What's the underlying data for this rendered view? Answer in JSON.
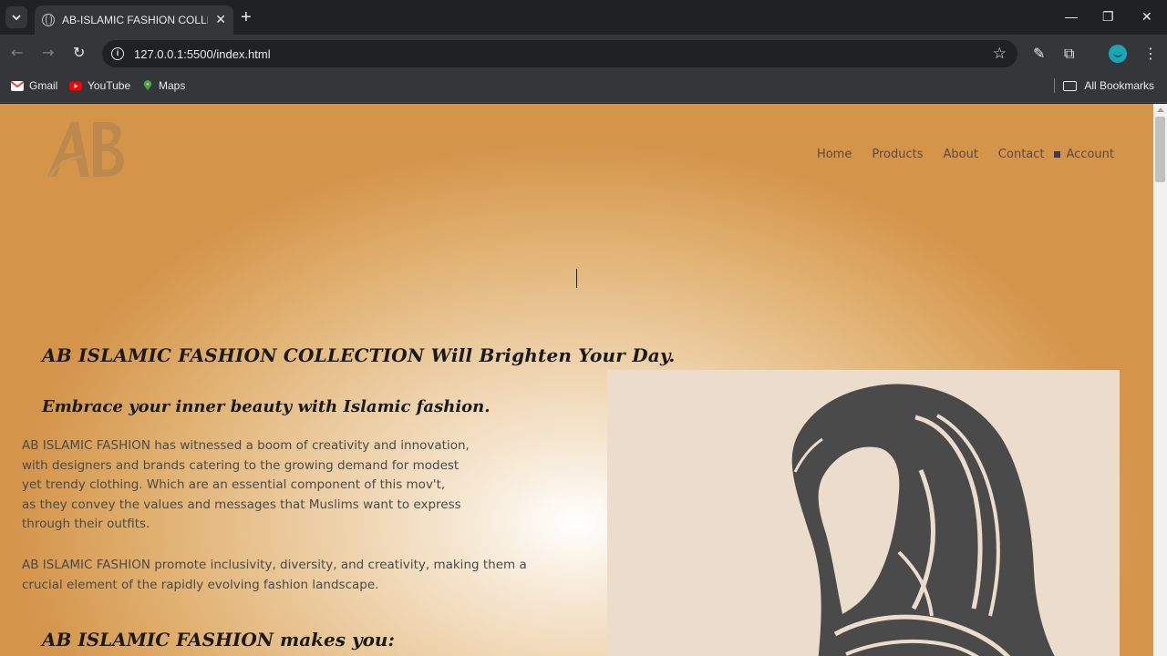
{
  "browser": {
    "tab_title": "AB-ISLAMIC FASHION COLLECTION",
    "url": "127.0.0.1:5500/index.html",
    "bookmarks": [
      {
        "label": "Gmail",
        "icon": "gmail-icon",
        "color": "#ea4335"
      },
      {
        "label": "YouTube",
        "icon": "youtube-icon",
        "color": "#ff0000"
      },
      {
        "label": "Maps",
        "icon": "maps-icon",
        "color": "#34a853"
      }
    ],
    "all_bookmarks": "All Bookmarks"
  },
  "site": {
    "logo_text": "AB",
    "nav": {
      "home": "Home",
      "products": "Products",
      "about": "About",
      "contact": "Contact",
      "account": "Account"
    },
    "hero": {
      "title": "AB ISLAMIC FASHION COLLECTION Will Brighten Your Day.",
      "subtitle": "Embrace your inner beauty with Islamic fashion.",
      "para1_lines": [
        "AB ISLAMIC FASHION has witnessed a boom of creativity and innovation,",
        "with designers and brands catering to the growing demand for modest",
        "yet trendy clothing. Which are an essential component of this mov't,",
        "as they convey the values and messages that Muslims want to express",
        "through their outfits."
      ],
      "para2_lines": [
        "AB ISLAMIC FASHION promote inclusivity, diversity, and creativity, making them a",
        "crucial element of the rapidly evolving fashion landscape."
      ],
      "makes_heading": "AB ISLAMIC FASHION makes you:"
    },
    "colors": {
      "accent_gold": "#d4944a",
      "hijab_gray": "#4a4a4a",
      "image_bg": "#ecdccb"
    }
  }
}
